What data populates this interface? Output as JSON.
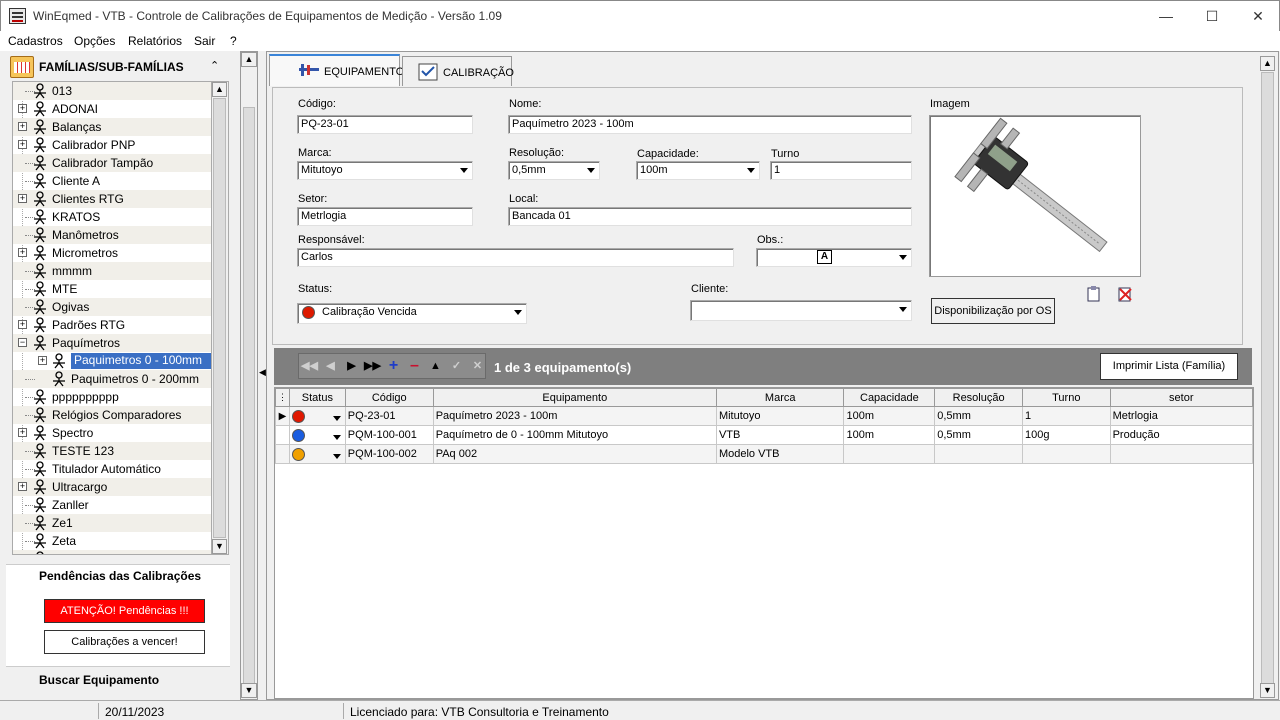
{
  "window": {
    "title": "WinEqmed - VTB - Controle de Calibrações de Equipamentos de Medição - Versão 1.09"
  },
  "menu": [
    "Cadastros",
    "Opções",
    "Relatórios",
    "Sair",
    "?"
  ],
  "families": {
    "title": "FAMÍLIAS/SUB-FAMÍLIAS",
    "items": [
      {
        "label": "013",
        "expand": false
      },
      {
        "label": "ADONAI",
        "expand": true
      },
      {
        "label": "Balanças",
        "expand": true
      },
      {
        "label": "Calibrador PNP",
        "expand": true
      },
      {
        "label": "Calibrador Tampão",
        "expand": false
      },
      {
        "label": "Cliente A",
        "expand": false
      },
      {
        "label": "Clientes RTG",
        "expand": true
      },
      {
        "label": "KRATOS",
        "expand": false
      },
      {
        "label": "Manômetros",
        "expand": false
      },
      {
        "label": "Micrometros",
        "expand": true
      },
      {
        "label": "mmmm",
        "expand": false
      },
      {
        "label": "MTE",
        "expand": false
      },
      {
        "label": "Ogivas",
        "expand": false
      },
      {
        "label": "Padrões RTG",
        "expand": true
      },
      {
        "label": "Paquímetros",
        "expand": "open"
      },
      {
        "label": "Paquimetros 0 - 100mm",
        "expand": true,
        "child": true,
        "selected": true
      },
      {
        "label": "Paquimetros 0 - 200mm",
        "expand": false,
        "child": true
      },
      {
        "label": "pppppppppp",
        "expand": false
      },
      {
        "label": "Relógios Comparadores",
        "expand": false
      },
      {
        "label": "Spectro",
        "expand": true
      },
      {
        "label": "TESTE 123",
        "expand": false
      },
      {
        "label": "Titulador Automático",
        "expand": false
      },
      {
        "label": "Ultracargo",
        "expand": true
      },
      {
        "label": "Zanller",
        "expand": false
      },
      {
        "label": "Ze1",
        "expand": false
      },
      {
        "label": "Zeta",
        "expand": false
      },
      {
        "label": "Zeus",
        "expand": false
      }
    ]
  },
  "pendencias": {
    "title": "Pendências das Calibrações",
    "alert_label": "ATENÇÃO!  Pendências !!!",
    "vencer_label": "Calibrações a vencer!"
  },
  "buscar": {
    "title": "Buscar Equipamento"
  },
  "tabs": [
    {
      "label": "EQUIPAMENTO",
      "active": true
    },
    {
      "label": "CALIBRAÇÃO",
      "active": false
    }
  ],
  "form": {
    "codigo": {
      "label": "Código:",
      "value": "PQ-23-01"
    },
    "nome": {
      "label": "Nome:",
      "value": "Paquímetro 2023 - 100m"
    },
    "marca": {
      "label": "Marca:",
      "value": "Mitutoyo"
    },
    "resolucao": {
      "label": "Resolução:",
      "value": "0,5mm"
    },
    "capacidade": {
      "label": "Capacidade:",
      "value": "100m"
    },
    "turno": {
      "label": "Turno",
      "value": "1"
    },
    "setor": {
      "label": "Setor:",
      "value": "Metrlogia"
    },
    "local": {
      "label": "Local:",
      "value": "Bancada 01"
    },
    "responsavel": {
      "label": "Responsável:",
      "value": "Carlos"
    },
    "obs": {
      "label": "Obs.:",
      "value": ""
    },
    "status": {
      "label": "Status:",
      "value": "Calibração Vencida",
      "color": "#dd1a00"
    },
    "cliente": {
      "label": "Cliente:",
      "value": ""
    },
    "imagem": {
      "label": "Imagem"
    },
    "os_button": "Disponibilização por OS"
  },
  "navigator": {
    "count_text": "1 de 3 equipamento(s)",
    "print_label": "Imprimir Lista (Família)"
  },
  "grid": {
    "columns": [
      "Status",
      "Código",
      "Equipamento",
      "Marca",
      "Capacidade",
      "Resolução",
      "Turno",
      "setor"
    ],
    "rows": [
      {
        "status_color": "#e01800",
        "codigo": "PQ-23-01",
        "equipamento": "Paquímetro 2023 - 100m",
        "marca": "Mitutoyo",
        "capacidade": "100m",
        "resolucao": "0,5mm",
        "turno": "1",
        "setor": "Metrlogia",
        "current": true
      },
      {
        "status_color": "#1a5de0",
        "codigo": "PQM-100-001",
        "equipamento": "Paquímetro de 0 - 100mm Mitutoyo",
        "marca": "VTB",
        "capacidade": "100m",
        "resolucao": "0,5mm",
        "turno": "100g",
        "setor": "Produção",
        "current": false
      },
      {
        "status_color": "#f0a000",
        "codigo": "PQM-100-002",
        "equipamento": "PAq 002",
        "marca": "Modelo VTB",
        "capacidade": "",
        "resolucao": "",
        "turno": "",
        "setor": "",
        "current": false
      }
    ]
  },
  "statusbar": {
    "date": "20/11/2023",
    "license": "Licenciado para: VTB Consultoria e Treinamento"
  }
}
